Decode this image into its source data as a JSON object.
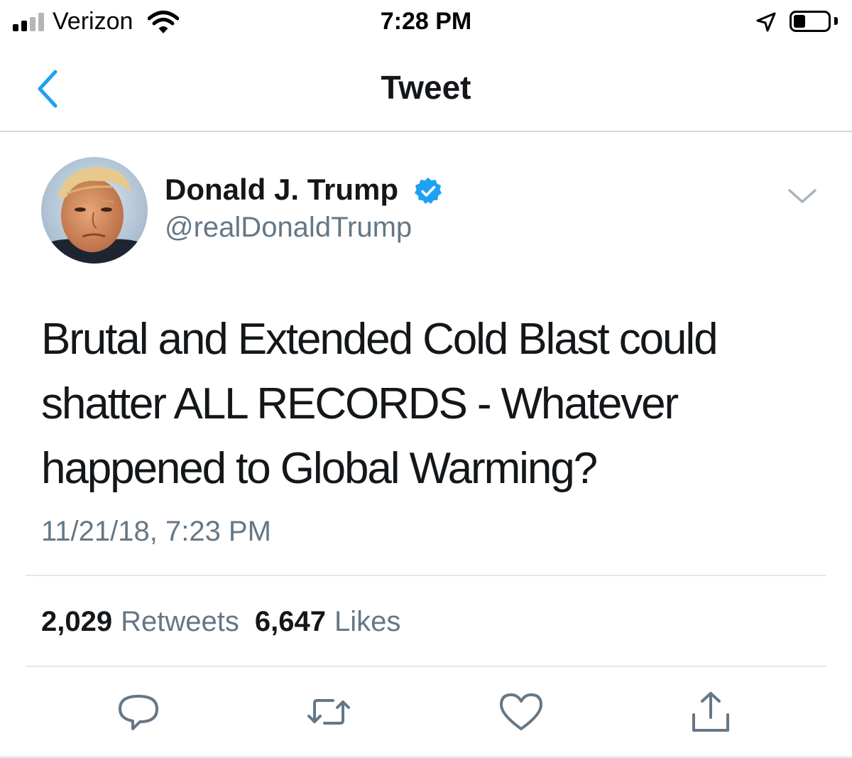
{
  "status_bar": {
    "carrier": "Verizon",
    "time": "7:28 PM",
    "signal_bars_active": 2,
    "signal_bars_total": 4,
    "battery_level": 0.35
  },
  "nav": {
    "title": "Tweet",
    "back_icon": "chevron-left-icon"
  },
  "tweet": {
    "author_name": "Donald J. Trump",
    "handle": "@realDonaldTrump",
    "verified": true,
    "text_lines": [
      "Brutal and Extended Cold Blast could",
      "shatter ALL RECORDS - Whatever",
      "happened to Global Warming?"
    ],
    "timestamp": "11/21/18, 7:23 PM",
    "retweets_count": "2,029",
    "retweets_label": "Retweets",
    "likes_count": "6,647",
    "likes_label": "Likes"
  },
  "actions": [
    "reply-icon",
    "retweet-icon",
    "like-icon",
    "share-icon"
  ],
  "colors": {
    "accent": "#1da1f2",
    "text_primary": "#14171a",
    "text_secondary": "#657786",
    "divider": "#e1e8ed"
  }
}
